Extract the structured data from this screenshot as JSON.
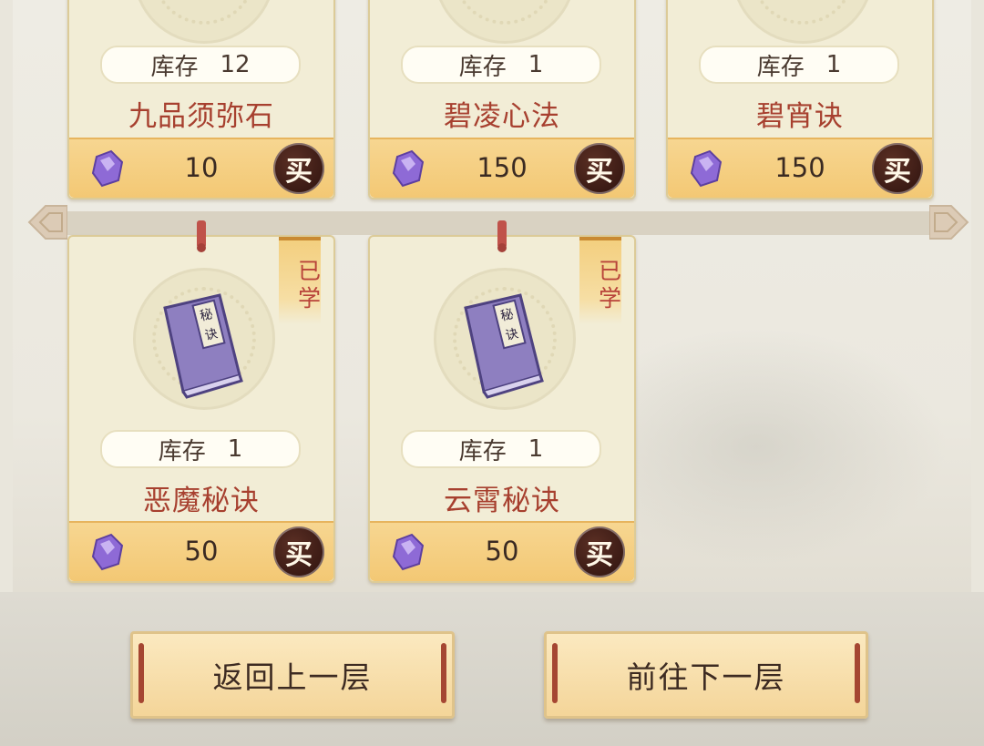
{
  "shop": {
    "stock_label": "库存",
    "buy_label": "买",
    "learned_label_1": "已",
    "learned_label_2": "学",
    "items": [
      {
        "name": "九品须弥石",
        "stock": "12",
        "price": "10",
        "learned": false
      },
      {
        "name": "碧凌心法",
        "stock": "1",
        "price": "150",
        "learned": false
      },
      {
        "name": "碧宵诀",
        "stock": "1",
        "price": "150",
        "learned": false
      },
      {
        "name": "恶魔秘诀",
        "stock": "1",
        "price": "50",
        "learned": true,
        "book_label_1": "秘",
        "book_label_2": "诀"
      },
      {
        "name": "云霄秘诀",
        "stock": "1",
        "price": "50",
        "learned": true,
        "book_label_1": "秘",
        "book_label_2": "诀"
      }
    ]
  },
  "nav": {
    "prev_label": "返回上一层",
    "next_label": "前往下一层"
  },
  "colors": {
    "currency_gem": "#8e6ad6",
    "buy_button": "#3a1a14",
    "item_name": "#a7402f"
  },
  "icons": {
    "currency": "purple-gem-icon",
    "book": "secret-book-icon"
  }
}
